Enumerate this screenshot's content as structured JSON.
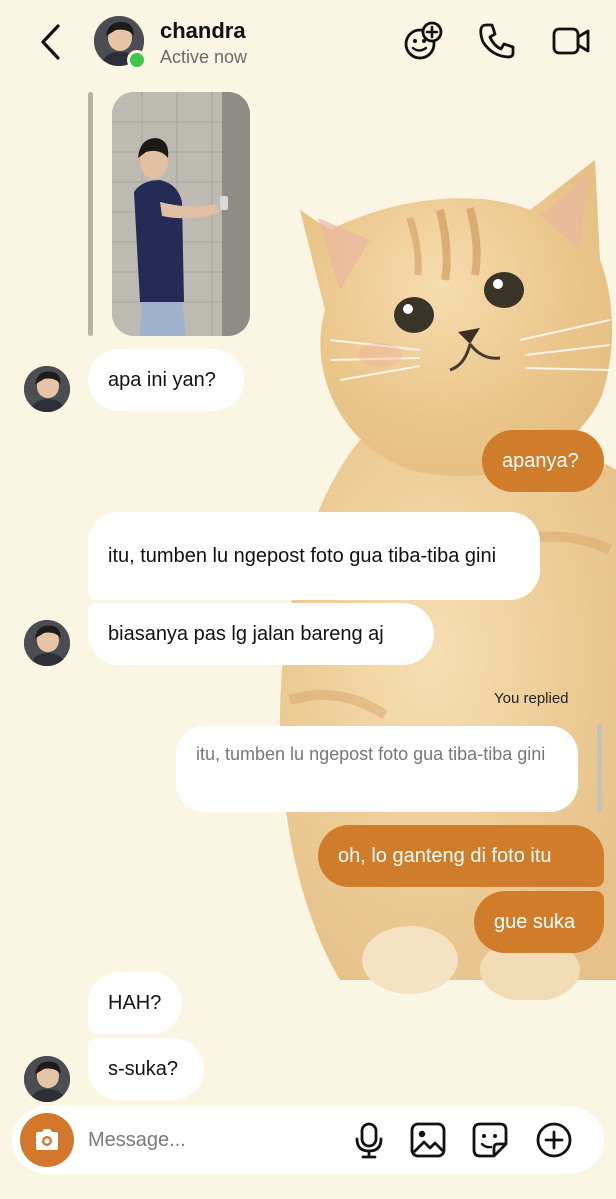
{
  "header": {
    "name": "chandra",
    "status": "Active now",
    "icons": [
      "back-chevron-icon",
      "effects-icon",
      "phone-icon",
      "video-icon"
    ]
  },
  "thread": {
    "shared_photo": "photo of a person leaning on a wall",
    "messages": [
      {
        "from": "them",
        "text": "apa ini yan?"
      },
      {
        "from": "me",
        "text": "apanya?"
      },
      {
        "from": "them",
        "text": "itu, tumben lu ngepost foto gua tiba-tiba gini"
      },
      {
        "from": "them",
        "text": "biasanya pas lg jalan bareng aj"
      },
      {
        "from": "me",
        "text": "oh, lo ganteng di foto itu",
        "reply_label": "You replied",
        "quoted": "itu, tumben lu ngepost foto gua tiba-tiba gini"
      },
      {
        "from": "me",
        "text": "gue suka"
      },
      {
        "from": "them",
        "text": "HAH?"
      },
      {
        "from": "them",
        "text": "s-suka?"
      }
    ]
  },
  "composer": {
    "placeholder": "Message...",
    "icons": [
      "camera-icon",
      "microphone-icon",
      "gallery-icon",
      "sticker-icon",
      "plus-icon"
    ]
  },
  "colors": {
    "background": "#fbf5e4",
    "outgoing_bubble": "#cf7d2b",
    "incoming_bubble": "#ffffff",
    "online": "#3ec74a"
  }
}
